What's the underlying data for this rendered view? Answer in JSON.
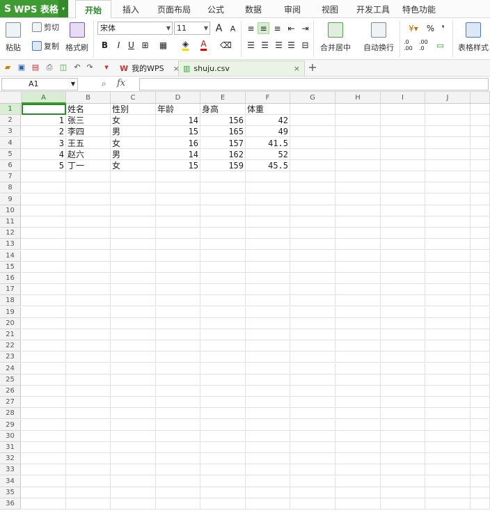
{
  "app": {
    "logo": "S",
    "name": "WPS 表格",
    "menu_arrow": "▾"
  },
  "menu_tabs": [
    "开始",
    "插入",
    "页面布局",
    "公式",
    "数据",
    "审阅",
    "视图",
    "开发工具",
    "特色功能"
  ],
  "ribbon": {
    "paste": "粘贴",
    "cut": "剪切",
    "copy": "复制",
    "format_painter": "格式刷",
    "font_name": "宋体",
    "font_size": "11",
    "bold": "B",
    "italic": "I",
    "underline": "U",
    "font_grow": "A",
    "font_shrink": "A",
    "merge_center": "合并居中",
    "auto_wrap": "自动换行",
    "percent": "%",
    "comma": "❜",
    "dec_inc": ".0 .00",
    "dec_dec": ".00 .0",
    "table_style": "表格样式"
  },
  "doc_tabs": [
    {
      "label": "我的WPS",
      "icon": "wps-logo-icon"
    },
    {
      "label": "shuju.csv",
      "icon": "csv-file-icon"
    }
  ],
  "formula_bar": {
    "cell_ref": "A1",
    "fx": "fx",
    "value": ""
  },
  "columns": [
    "A",
    "B",
    "C",
    "D",
    "E",
    "F",
    "G",
    "H",
    "I",
    "J"
  ],
  "rows": [
    "1",
    "2",
    "3",
    "4",
    "5",
    "6",
    "7",
    "8",
    "9",
    "10",
    "11",
    "12",
    "13",
    "14",
    "15",
    "16",
    "17",
    "18",
    "19",
    "20",
    "21",
    "22",
    "23",
    "24",
    "25",
    "26",
    "27",
    "28",
    "29",
    "30",
    "31",
    "32",
    "33",
    "34",
    "35",
    "36"
  ],
  "headers": [
    "姓名",
    "性别",
    "年龄",
    "身高",
    "体重"
  ],
  "data_rows": [
    {
      "id": "1",
      "name": "张三",
      "gender": "女",
      "age": "14",
      "height": "156",
      "weight": "42"
    },
    {
      "id": "2",
      "name": "李四",
      "gender": "男",
      "age": "15",
      "height": "165",
      "weight": "49"
    },
    {
      "id": "3",
      "name": "王五",
      "gender": "女",
      "age": "16",
      "height": "157",
      "weight": "41.5"
    },
    {
      "id": "4",
      "name": "赵六",
      "gender": "男",
      "age": "14",
      "height": "162",
      "weight": "52"
    },
    {
      "id": "5",
      "name": "丁一",
      "gender": "女",
      "age": "15",
      "height": "159",
      "weight": "45.5"
    }
  ],
  "colors": {
    "accent": "#3f9c35",
    "selection": "#2a8a2a"
  }
}
